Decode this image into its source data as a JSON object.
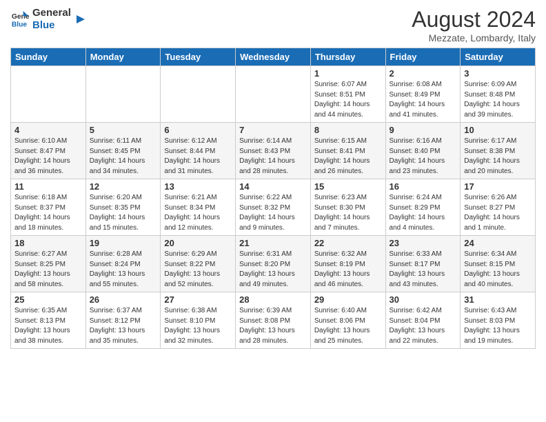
{
  "header": {
    "logo_line1": "General",
    "logo_line2": "Blue",
    "month_year": "August 2024",
    "location": "Mezzate, Lombardy, Italy"
  },
  "days_of_week": [
    "Sunday",
    "Monday",
    "Tuesday",
    "Wednesday",
    "Thursday",
    "Friday",
    "Saturday"
  ],
  "weeks": [
    [
      {
        "day": "",
        "info": ""
      },
      {
        "day": "",
        "info": ""
      },
      {
        "day": "",
        "info": ""
      },
      {
        "day": "",
        "info": ""
      },
      {
        "day": "1",
        "info": "Sunrise: 6:07 AM\nSunset: 8:51 PM\nDaylight: 14 hours\nand 44 minutes."
      },
      {
        "day": "2",
        "info": "Sunrise: 6:08 AM\nSunset: 8:49 PM\nDaylight: 14 hours\nand 41 minutes."
      },
      {
        "day": "3",
        "info": "Sunrise: 6:09 AM\nSunset: 8:48 PM\nDaylight: 14 hours\nand 39 minutes."
      }
    ],
    [
      {
        "day": "4",
        "info": "Sunrise: 6:10 AM\nSunset: 8:47 PM\nDaylight: 14 hours\nand 36 minutes."
      },
      {
        "day": "5",
        "info": "Sunrise: 6:11 AM\nSunset: 8:45 PM\nDaylight: 14 hours\nand 34 minutes."
      },
      {
        "day": "6",
        "info": "Sunrise: 6:12 AM\nSunset: 8:44 PM\nDaylight: 14 hours\nand 31 minutes."
      },
      {
        "day": "7",
        "info": "Sunrise: 6:14 AM\nSunset: 8:43 PM\nDaylight: 14 hours\nand 28 minutes."
      },
      {
        "day": "8",
        "info": "Sunrise: 6:15 AM\nSunset: 8:41 PM\nDaylight: 14 hours\nand 26 minutes."
      },
      {
        "day": "9",
        "info": "Sunrise: 6:16 AM\nSunset: 8:40 PM\nDaylight: 14 hours\nand 23 minutes."
      },
      {
        "day": "10",
        "info": "Sunrise: 6:17 AM\nSunset: 8:38 PM\nDaylight: 14 hours\nand 20 minutes."
      }
    ],
    [
      {
        "day": "11",
        "info": "Sunrise: 6:18 AM\nSunset: 8:37 PM\nDaylight: 14 hours\nand 18 minutes."
      },
      {
        "day": "12",
        "info": "Sunrise: 6:20 AM\nSunset: 8:35 PM\nDaylight: 14 hours\nand 15 minutes."
      },
      {
        "day": "13",
        "info": "Sunrise: 6:21 AM\nSunset: 8:34 PM\nDaylight: 14 hours\nand 12 minutes."
      },
      {
        "day": "14",
        "info": "Sunrise: 6:22 AM\nSunset: 8:32 PM\nDaylight: 14 hours\nand 9 minutes."
      },
      {
        "day": "15",
        "info": "Sunrise: 6:23 AM\nSunset: 8:30 PM\nDaylight: 14 hours\nand 7 minutes."
      },
      {
        "day": "16",
        "info": "Sunrise: 6:24 AM\nSunset: 8:29 PM\nDaylight: 14 hours\nand 4 minutes."
      },
      {
        "day": "17",
        "info": "Sunrise: 6:26 AM\nSunset: 8:27 PM\nDaylight: 14 hours\nand 1 minute."
      }
    ],
    [
      {
        "day": "18",
        "info": "Sunrise: 6:27 AM\nSunset: 8:25 PM\nDaylight: 13 hours\nand 58 minutes."
      },
      {
        "day": "19",
        "info": "Sunrise: 6:28 AM\nSunset: 8:24 PM\nDaylight: 13 hours\nand 55 minutes."
      },
      {
        "day": "20",
        "info": "Sunrise: 6:29 AM\nSunset: 8:22 PM\nDaylight: 13 hours\nand 52 minutes."
      },
      {
        "day": "21",
        "info": "Sunrise: 6:31 AM\nSunset: 8:20 PM\nDaylight: 13 hours\nand 49 minutes."
      },
      {
        "day": "22",
        "info": "Sunrise: 6:32 AM\nSunset: 8:19 PM\nDaylight: 13 hours\nand 46 minutes."
      },
      {
        "day": "23",
        "info": "Sunrise: 6:33 AM\nSunset: 8:17 PM\nDaylight: 13 hours\nand 43 minutes."
      },
      {
        "day": "24",
        "info": "Sunrise: 6:34 AM\nSunset: 8:15 PM\nDaylight: 13 hours\nand 40 minutes."
      }
    ],
    [
      {
        "day": "25",
        "info": "Sunrise: 6:35 AM\nSunset: 8:13 PM\nDaylight: 13 hours\nand 38 minutes."
      },
      {
        "day": "26",
        "info": "Sunrise: 6:37 AM\nSunset: 8:12 PM\nDaylight: 13 hours\nand 35 minutes."
      },
      {
        "day": "27",
        "info": "Sunrise: 6:38 AM\nSunset: 8:10 PM\nDaylight: 13 hours\nand 32 minutes."
      },
      {
        "day": "28",
        "info": "Sunrise: 6:39 AM\nSunset: 8:08 PM\nDaylight: 13 hours\nand 28 minutes."
      },
      {
        "day": "29",
        "info": "Sunrise: 6:40 AM\nSunset: 8:06 PM\nDaylight: 13 hours\nand 25 minutes."
      },
      {
        "day": "30",
        "info": "Sunrise: 6:42 AM\nSunset: 8:04 PM\nDaylight: 13 hours\nand 22 minutes."
      },
      {
        "day": "31",
        "info": "Sunrise: 6:43 AM\nSunset: 8:03 PM\nDaylight: 13 hours\nand 19 minutes."
      }
    ]
  ]
}
